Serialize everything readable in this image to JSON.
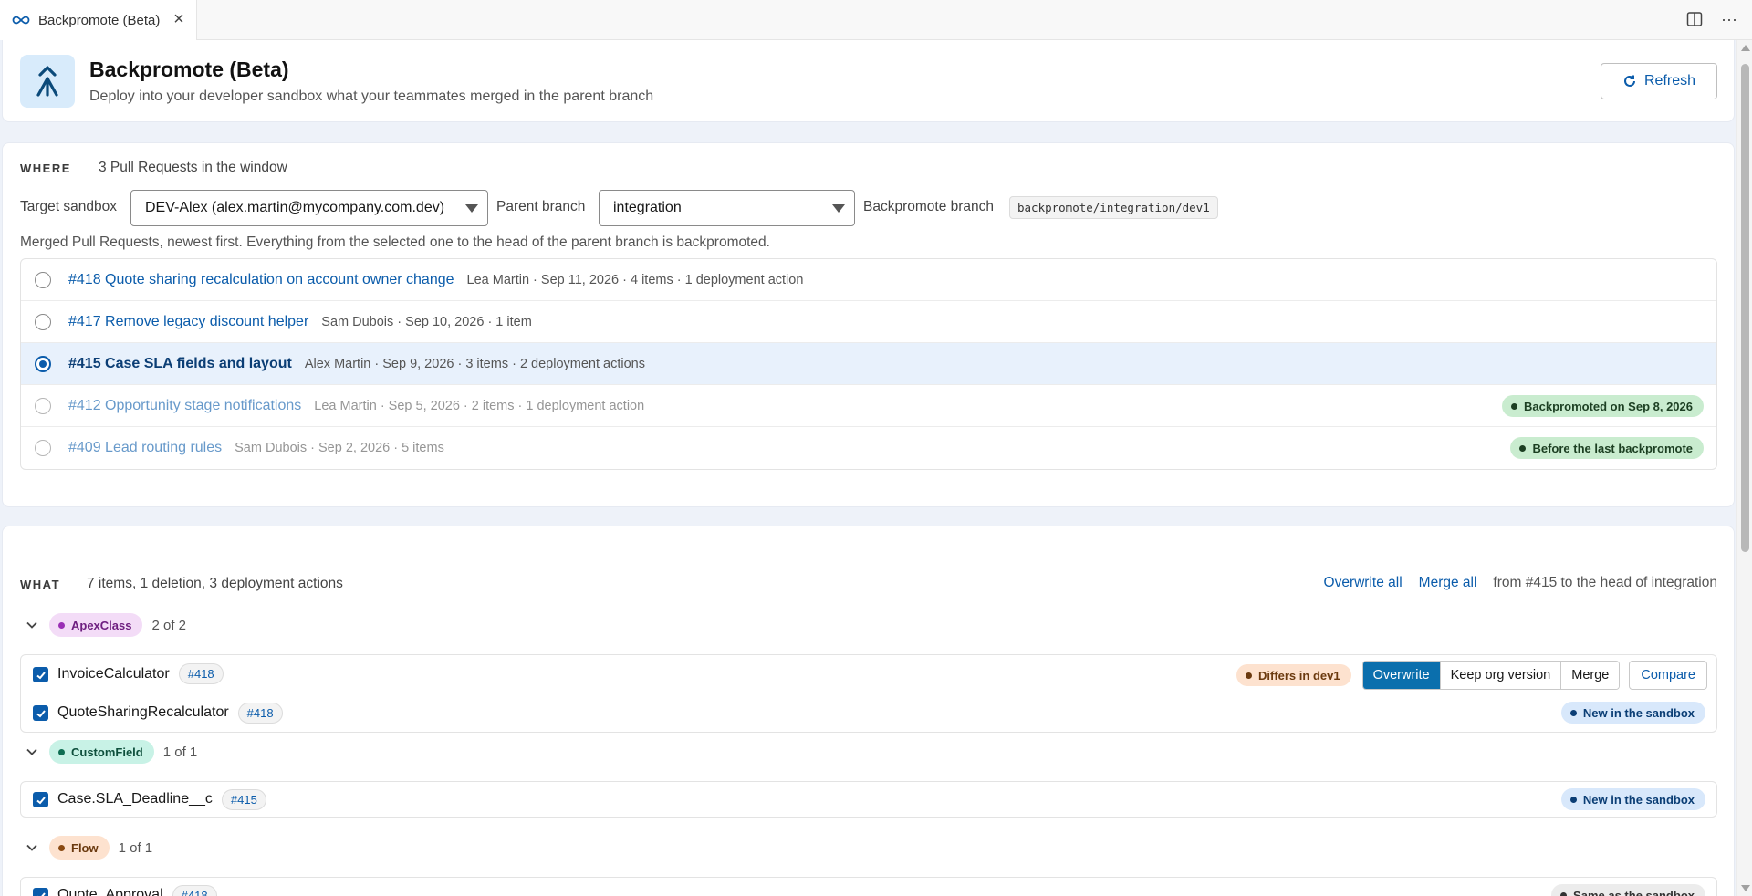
{
  "tab": {
    "label": "Backpromote (Beta)"
  },
  "header": {
    "title": "Backpromote (Beta)",
    "subtitle": "Deploy into your developer sandbox what your teammates merged in the parent branch",
    "refresh_label": "Refresh"
  },
  "where": {
    "label": "WHERE",
    "summary": "3 Pull Requests in the window",
    "target_label": "Target sandbox",
    "target_value": "DEV-Alex (alex.martin@mycompany.com.dev)",
    "parent_label": "Parent branch",
    "parent_value": "integration",
    "backpromote_label": "Backpromote branch",
    "backpromote_value": "backpromote/integration/dev1",
    "hint": "Merged Pull Requests, newest first. Everything from the selected one to the head of the parent branch is backpromoted.",
    "prs": [
      {
        "title": "#418 Quote sharing recalculation on account owner change",
        "meta": "Lea Martin · Sep 11, 2026 · 4 items · 1 deployment action",
        "selected": false,
        "badge": ""
      },
      {
        "title": "#417 Remove legacy discount helper",
        "meta": "Sam Dubois · Sep 10, 2026 · 1 item",
        "selected": false,
        "badge": ""
      },
      {
        "title": "#415 Case SLA fields and layout",
        "meta": "Alex Martin · Sep 9, 2026 · 3 items · 2 deployment actions",
        "selected": true,
        "badge": ""
      },
      {
        "title": "#412 Opportunity stage notifications",
        "meta": "Lea Martin · Sep 5, 2026 · 2 items · 1 deployment action",
        "selected": false,
        "badge": "Backpromoted on Sep 8, 2026"
      },
      {
        "title": "#409 Lead routing rules",
        "meta": "Sam Dubois · Sep 2, 2026 · 5 items",
        "selected": false,
        "badge": "Before the last backpromote"
      }
    ]
  },
  "what": {
    "label": "WHAT",
    "summary": "7 items, 1 deletion, 3 deployment actions",
    "overwrite_all": "Overwrite all",
    "merge_all": "Merge all",
    "range_text": "from #415 to the head of integration",
    "groups": [
      {
        "type": "ApexClass",
        "count": "2 of 2",
        "color": "#f3dcf7",
        "text_color": "#6e1f80",
        "dot": "#9a2fb5",
        "items": [
          {
            "name": "InvoiceCalculator",
            "pr": "#418",
            "status": "Differs in dev1"
          },
          {
            "name": "QuoteSharingRecalculator",
            "pr": "#418",
            "status": "New in the sandbox"
          }
        ]
      },
      {
        "type": "CustomField",
        "count": "1 of 1",
        "color": "#c8f2e6",
        "text_color": "#0e4f3c",
        "dot": "#0e6e52",
        "items": [
          {
            "name": "Case.SLA_Deadline__c",
            "pr": "#415",
            "status": "New in the sandbox"
          }
        ]
      },
      {
        "type": "Flow",
        "count": "1 of 1",
        "color": "#fde2cf",
        "text_color": "#6b3a0f",
        "dot": "#8a4a12",
        "items": [
          {
            "name": "Quote_Approval",
            "pr": "#418",
            "status": "Same as the sandbox"
          }
        ]
      }
    ],
    "actions": {
      "overwrite": "Overwrite",
      "keep": "Keep org version",
      "merge": "Merge",
      "compare": "Compare"
    }
  }
}
